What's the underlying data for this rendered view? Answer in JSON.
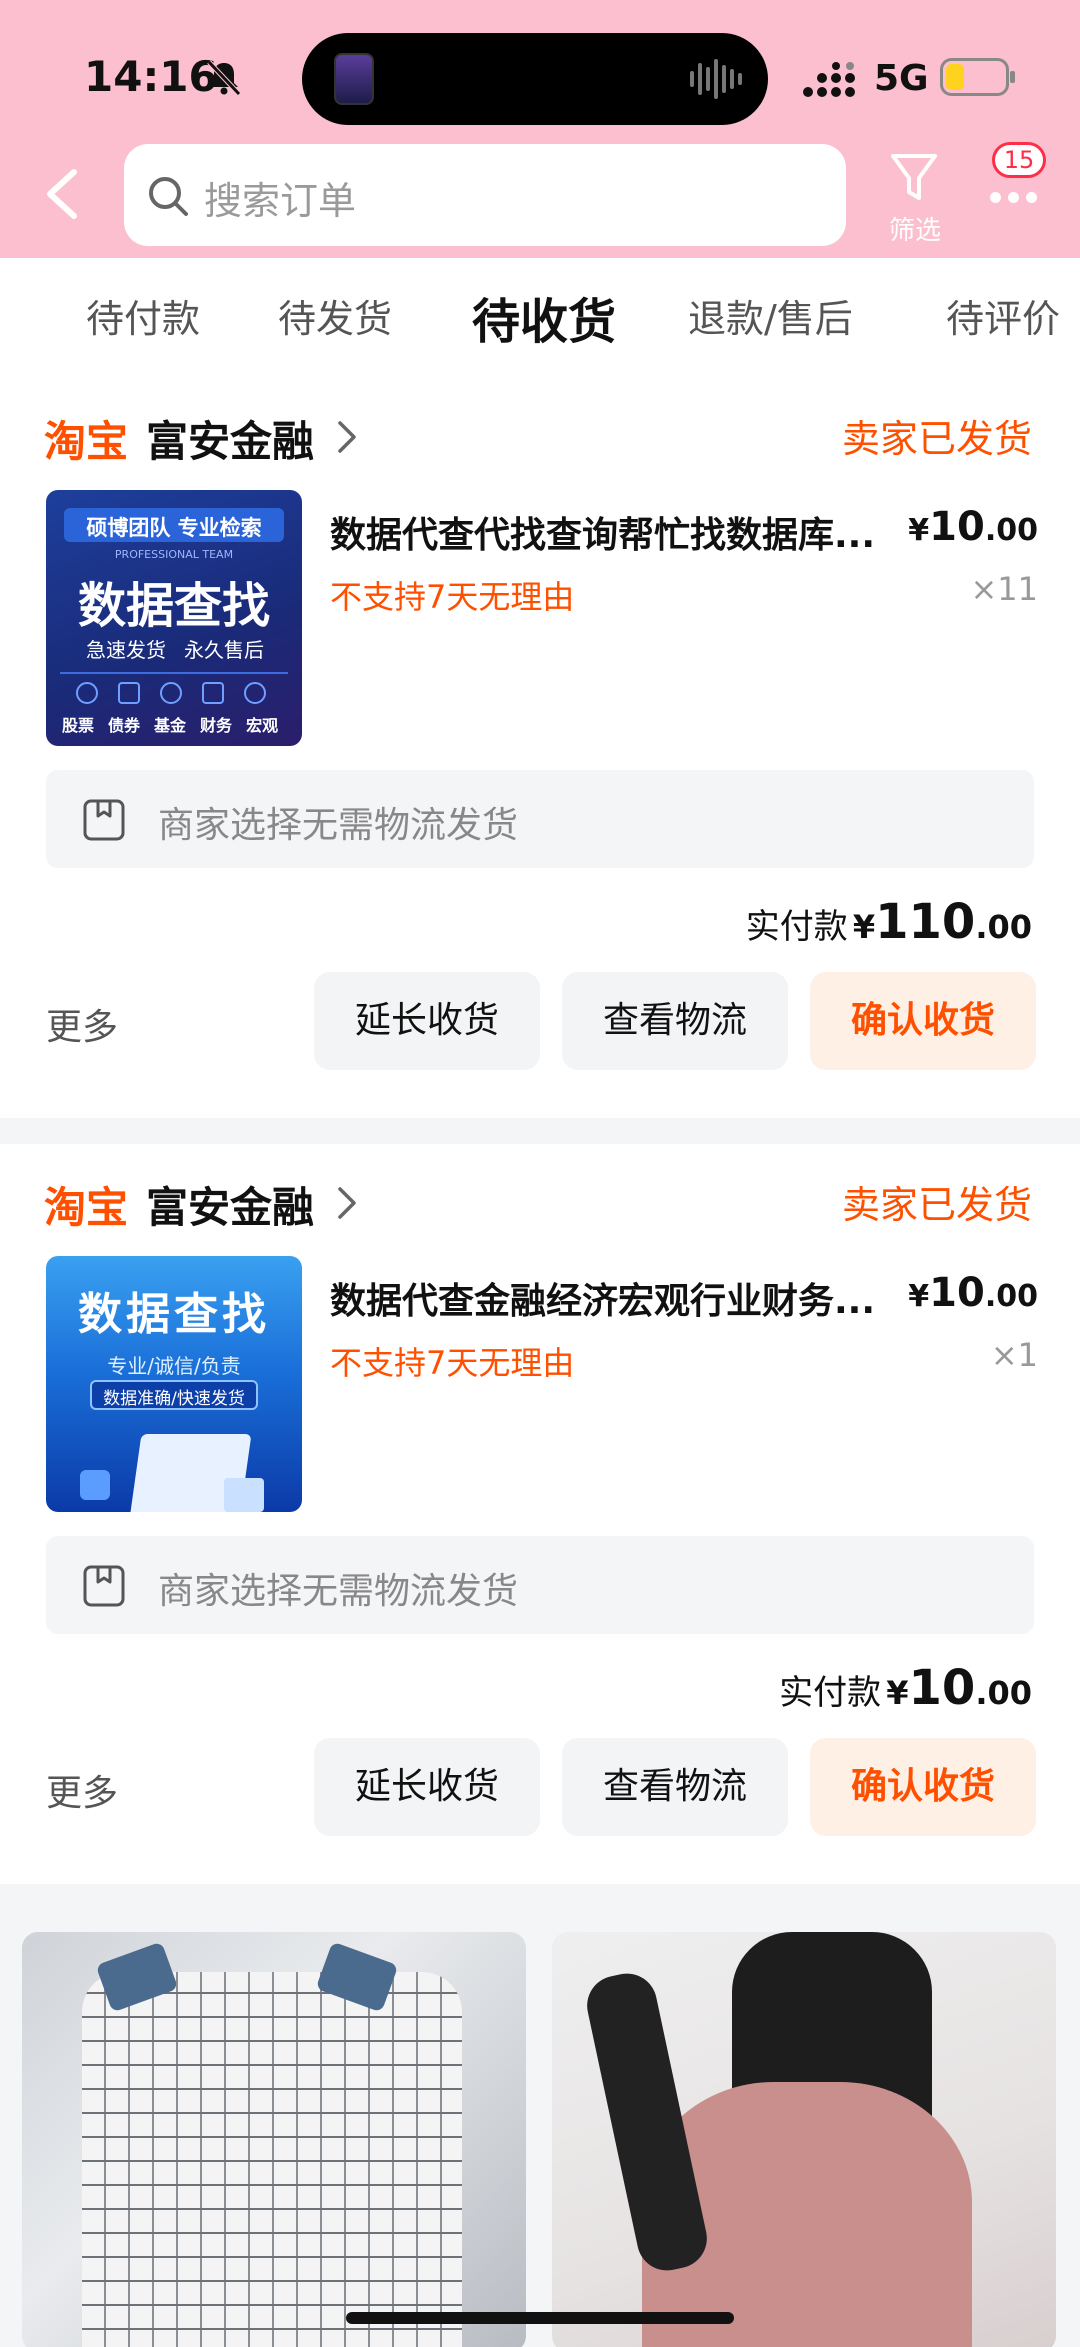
{
  "status_bar": {
    "time": "14:16",
    "network": "5G"
  },
  "header": {
    "search_placeholder": "搜索订单",
    "filter_label": "筛选",
    "message_badge": "15"
  },
  "tabs": [
    {
      "label": "待付款"
    },
    {
      "label": "待发货"
    },
    {
      "label": "待收货",
      "active": true
    },
    {
      "label": "退款/售后"
    },
    {
      "label": "待评价"
    }
  ],
  "orders": [
    {
      "platform": "淘宝",
      "shop": "富安金融",
      "status": "卖家已发货",
      "product_title": "数据代查代找查询帮忙找数据库...",
      "price_symbol": "¥",
      "price_int": "10",
      "price_dec": ".00",
      "policy": "不支持7天无理由",
      "quantity": "×11",
      "thumb_texts": [
        "硕博团队 专业检索",
        "PROFESSIONAL TEAM",
        "数据查找",
        "急速发货",
        "永久售后",
        "股票",
        "债券",
        "基金",
        "财务",
        "宏观"
      ],
      "logistics": "商家选择无需物流发货",
      "paid_label": "实付款",
      "paid_symbol": "¥",
      "paid_int": "110",
      "paid_dec": ".00",
      "more": "更多",
      "buttons": [
        "延长收货",
        "查看物流",
        "确认收货"
      ]
    },
    {
      "platform": "淘宝",
      "shop": "富安金融",
      "status": "卖家已发货",
      "product_title": "数据代查金融经济宏观行业财务...",
      "price_symbol": "¥",
      "price_int": "10",
      "price_dec": ".00",
      "policy": "不支持7天无理由",
      "quantity": "×1",
      "thumb_texts": [
        "数据查找",
        "专业/诚信/负责",
        "数据准确/快速发货"
      ],
      "logistics": "商家选择无需物流发货",
      "paid_label": "实付款",
      "paid_symbol": "¥",
      "paid_int": "10",
      "paid_dec": ".00",
      "more": "更多",
      "buttons": [
        "延长收货",
        "查看物流",
        "确认收货"
      ]
    }
  ],
  "colors": {
    "header_bg": "#fbbfcf",
    "accent": "#ff5000",
    "badge": "#ff2e47"
  }
}
